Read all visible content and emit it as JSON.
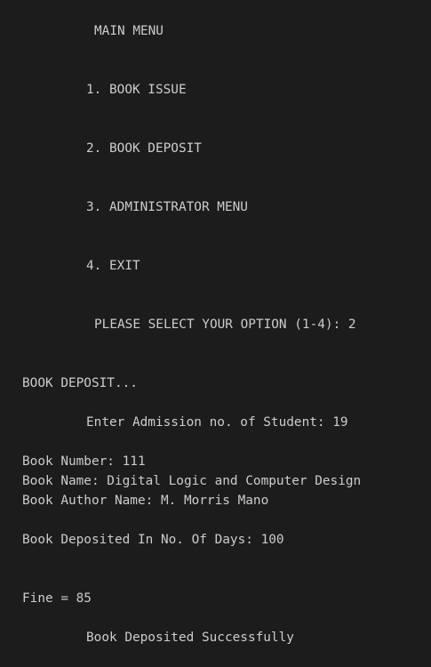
{
  "terminal": {
    "main_menu_title": "MAIN MENU",
    "options": [
      "1. BOOK ISSUE",
      "2. BOOK DEPOSIT",
      "3. ADMINISTRATOR MENU",
      "4. EXIT"
    ],
    "select_prompt": "PLEASE SELECT YOUR OPTION (1-4): 2",
    "section_heading": "BOOK DEPOSIT...",
    "admission_prompt": "Enter Admission no. of Student: 19",
    "book_number": "Book Number: 111",
    "book_name": "Book Name: Digital Logic and Computer Design",
    "book_author": "Book Author Name: M. Morris Mano",
    "days_deposited": "Book Deposited In No. Of Days: 100",
    "fine": "Fine = 85",
    "success_message": "Book Deposited Successfully"
  },
  "colors": {
    "background": "#1c1c1c",
    "text": "#cccccc"
  }
}
